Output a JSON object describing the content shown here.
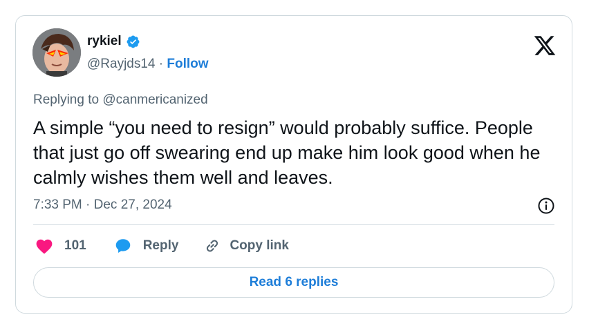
{
  "tweet": {
    "display_name": "rykiel",
    "handle": "@Rayjds14",
    "separator": " · ",
    "follow_label": "Follow",
    "replying_to": "Replying to @canmericanized",
    "text": "A simple “you need to resign” would probably suffice. People that just go off swearing end up make him look good when he calmly wishes them well and leaves.",
    "timestamp": "7:33 PM · Dec 27, 2024"
  },
  "actions": {
    "like_count": "101",
    "reply_label": "Reply",
    "copy_label": "Copy link"
  },
  "read_replies_label": "Read 6 replies",
  "colors": {
    "accent_blue": "#1d7dd8",
    "like_pink": "#f91880",
    "reply_blue": "#1d9bf0",
    "muted_text": "#536471",
    "border": "#cfd9de"
  },
  "icons": [
    "verified-badge-icon",
    "x-logo-icon",
    "info-icon",
    "heart-icon",
    "reply-bubble-icon",
    "link-icon"
  ]
}
